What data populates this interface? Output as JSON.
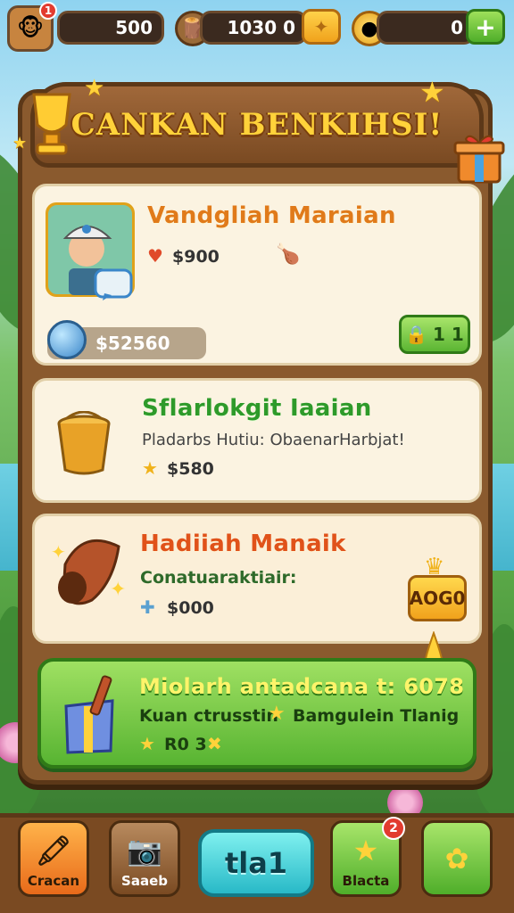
{
  "topbar": {
    "avatar_badge": "1",
    "resource1_value": "500",
    "resource2_value": "1030 0",
    "resource3_value": "0",
    "icons": [
      "monkey-avatar-icon",
      "wood-barrel-icon",
      "gold-chest-icon",
      "gold-coin-icon",
      "plus-icon"
    ]
  },
  "title": "CANKAN BENKIHSI!",
  "cards": [
    {
      "title": "Vandgliah Maraian",
      "price": "$900",
      "progress_label": "$52560",
      "button_label": "1 1",
      "icons": [
        "explorer-character-icon",
        "heart-icon",
        "bone-icon",
        "chat-bubble-icon",
        "lock-icon"
      ]
    },
    {
      "title": "Sflarlokgit Iaaian",
      "subtitle": "Pladarbs Hutiu: ObaenarHarbjat!",
      "price": "$580",
      "icons": [
        "bucket-icon",
        "star-icon"
      ]
    },
    {
      "title": "Hadiiah Manaik",
      "subtitle": "Conatuaraktiair:",
      "price": "$000",
      "button_label": "AOG0",
      "icons": [
        "horn-icon",
        "sparkle-icon",
        "gem-icon",
        "crown-icon"
      ]
    },
    {
      "title": "Miolarh antadcana t: 6078",
      "subtitle": "Kuan ctrusstin",
      "subtitle2": "Bamgulein Tlanig",
      "reward": "R0 3",
      "icons": [
        "gift-box-icon",
        "star-icon",
        "bow-icon"
      ]
    }
  ],
  "nav": {
    "btn1_label": "Cracan",
    "btn2_label": "Saaeb",
    "play_label": "tla1",
    "btn4_label": "Blacta",
    "btn4_badge": "2",
    "icons": [
      "crayon-icon",
      "camera-icon",
      "star-badge-icon",
      "puzzle-icon"
    ]
  },
  "colors": {
    "wood": "#8a5a2e",
    "gold": "#ffd23a",
    "green": "#58b432",
    "card_bg": "#fbf3e1",
    "teal": "#28b9c7"
  }
}
